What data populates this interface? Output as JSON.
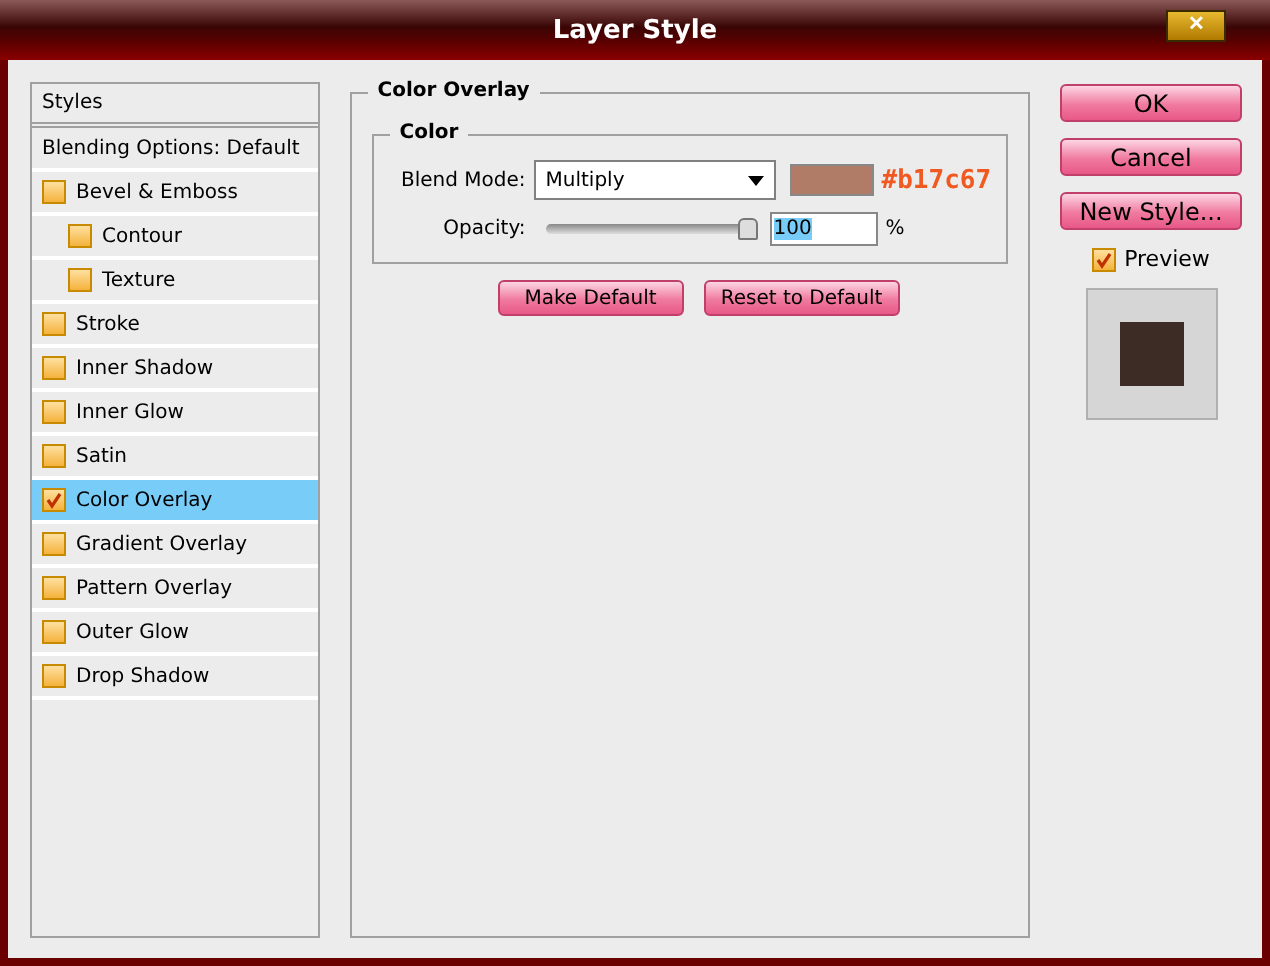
{
  "window": {
    "title": "Layer Style",
    "close": "✕"
  },
  "styles_panel": {
    "header": "Styles",
    "blending": "Blending Options: Default",
    "items": [
      {
        "label": "Bevel & Emboss",
        "checked": false,
        "selected": false,
        "children": [
          {
            "label": "Contour",
            "checked": false,
            "selected": false
          },
          {
            "label": "Texture",
            "checked": false,
            "selected": false
          }
        ]
      },
      {
        "label": "Stroke",
        "checked": false,
        "selected": false
      },
      {
        "label": "Inner Shadow",
        "checked": false,
        "selected": false
      },
      {
        "label": "Inner Glow",
        "checked": false,
        "selected": false
      },
      {
        "label": "Satin",
        "checked": false,
        "selected": false
      },
      {
        "label": "Color Overlay",
        "checked": true,
        "selected": true
      },
      {
        "label": "Gradient Overlay",
        "checked": false,
        "selected": false
      },
      {
        "label": "Pattern Overlay",
        "checked": false,
        "selected": false
      },
      {
        "label": "Outer Glow",
        "checked": false,
        "selected": false
      },
      {
        "label": "Drop Shadow",
        "checked": false,
        "selected": false
      }
    ]
  },
  "color_overlay": {
    "title": "Color Overlay",
    "group_title": "Color",
    "blend_mode_label": "Blend Mode:",
    "blend_mode": "Multiply",
    "swatch": {
      "color": "#b17c67"
    },
    "annotation": "#b17c67",
    "opacity_label": "Opacity:",
    "opacity": {
      "level": 1
    },
    "opacity_value": "100",
    "percent": "%",
    "buttons": [
      "Make Default",
      "Reset to Default"
    ]
  },
  "actions": {
    "buttons": [
      "OK",
      "Cancel",
      "New Style..."
    ],
    "preview": {
      "label": "Preview",
      "checked": true
    },
    "preview_thumb": {
      "color": "#3d2b25"
    }
  }
}
